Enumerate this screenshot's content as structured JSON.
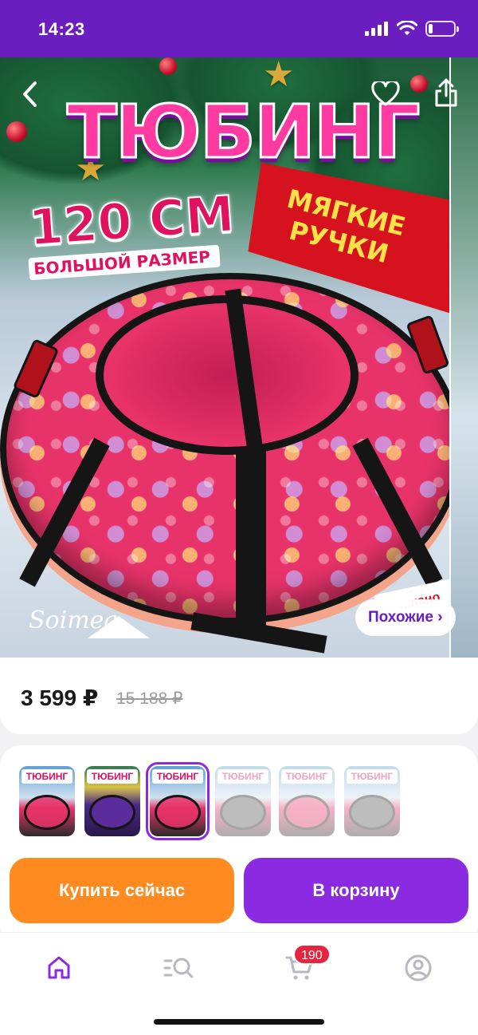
{
  "status_bar": {
    "time": "14:23"
  },
  "hero": {
    "title": "ТЮБИНГ",
    "size_main": "120 СМ",
    "size_sub": "БОЛЬШОЙ РАЗМЕР",
    "handles_text": "МЯГКИЕ РУЧКИ",
    "badge_partial": "...лано",
    "brand": "Soimea",
    "similar_button": "Похожие ›"
  },
  "product": {
    "price": "3 599 ₽",
    "old_price": "15 188 ₽"
  },
  "variants": {
    "thumbnails": [
      {
        "caption": "ТЮБИНГ",
        "state": "default"
      },
      {
        "caption": "ТЮБИНГ",
        "state": "default"
      },
      {
        "caption": "ТЮБИНГ",
        "state": "selected"
      },
      {
        "caption": "ТЮБИНГ",
        "state": "unavailable"
      },
      {
        "caption": "ТЮБИНГ",
        "state": "unavailable"
      },
      {
        "caption": "ТЮБИНГ",
        "state": "unavailable"
      }
    ]
  },
  "actions": {
    "buy_now": "Купить сейчас",
    "add_to_cart": "В корзину"
  },
  "tab_bar": {
    "items": [
      {
        "name": "home",
        "icon": "home-icon",
        "active": true
      },
      {
        "name": "catalog",
        "icon": "catalog-search-icon",
        "active": false
      },
      {
        "name": "cart",
        "icon": "cart-icon",
        "active": false
      },
      {
        "name": "profile",
        "icon": "profile-icon",
        "active": false
      }
    ],
    "cart_count": "190"
  },
  "colors": {
    "brand_purple": "#6a1ec0",
    "accent_violet": "#8a2be2",
    "buy_orange": "#ff8a1f",
    "badge_red": "#e5243f"
  }
}
